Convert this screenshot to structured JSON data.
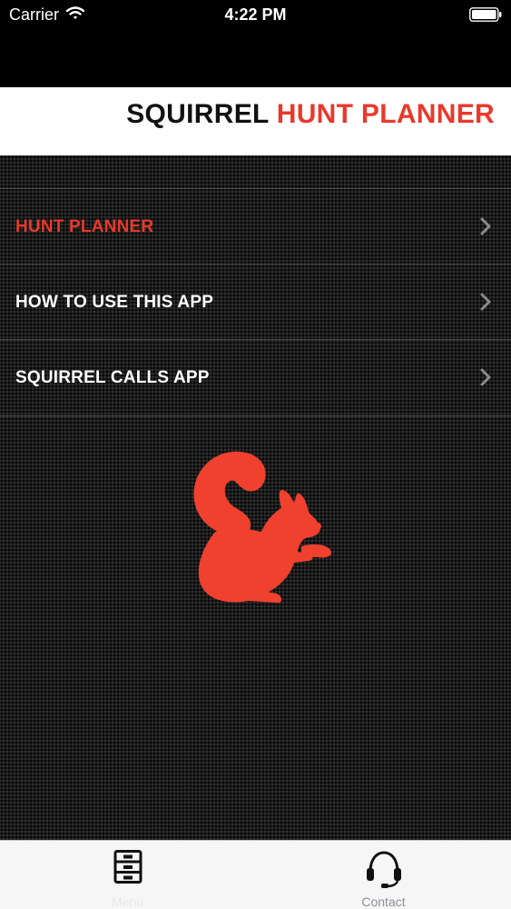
{
  "status_bar": {
    "carrier": "Carrier",
    "time": "4:22 PM",
    "signal_icon": "wifi-icon",
    "battery_icon": "battery-icon"
  },
  "header": {
    "title_part1": "SQUIRREL",
    "title_part2": "HUNT PLANNER"
  },
  "menu": {
    "items": [
      {
        "label": "HUNT PLANNER",
        "active": true,
        "icon": "chevron-right-icon"
      },
      {
        "label": "HOW TO USE THIS APP",
        "active": false,
        "icon": "chevron-right-icon"
      },
      {
        "label": "SQUIRREL CALLS APP",
        "active": false,
        "icon": "chevron-right-icon"
      }
    ]
  },
  "logo": {
    "icon": "squirrel-icon"
  },
  "tab_bar": {
    "tabs": [
      {
        "label": "Menu",
        "icon": "cabinet-icon",
        "selected": true
      },
      {
        "label": "Contact",
        "icon": "headset-icon",
        "selected": false
      }
    ]
  },
  "colors": {
    "accent": "#e8392c",
    "background": "#1e1e1e",
    "header_bg": "#ffffff",
    "tab_bar_bg": "#f6f6f6"
  }
}
